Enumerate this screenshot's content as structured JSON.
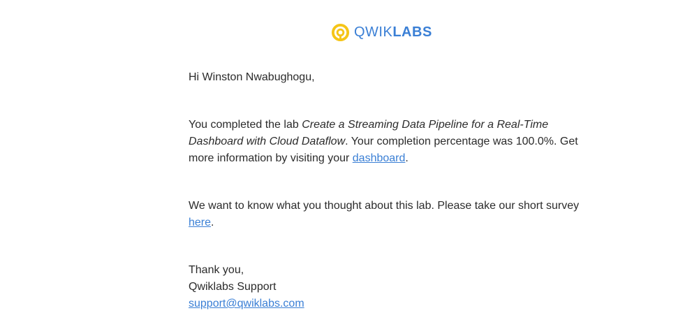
{
  "brand": {
    "name_light": "QWIK",
    "name_bold": "LABS",
    "accent_color": "#3a7fd5",
    "icon_color": "#f5c518",
    "icon": "qwiklabs-logo-icon"
  },
  "email": {
    "greeting": "Hi Winston Nwabughogu,",
    "completion": {
      "prefix": "You completed the lab ",
      "lab_title": "Create a Streaming Data Pipeline for a Real-Time Dashboard with Cloud Dataflow",
      "middle": ". Your completion percentage was 100.0%. Get more information by visiting your ",
      "link_text": "dashboard",
      "suffix": "."
    },
    "survey": {
      "prefix": "We want to know what you thought about this lab. Please take our short survey ",
      "link_text": "here",
      "suffix": "."
    },
    "signoff": {
      "thanks": "Thank you,",
      "sender": "Qwiklabs Support",
      "email": "support@qwiklabs.com"
    }
  }
}
